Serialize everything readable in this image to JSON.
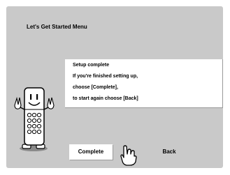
{
  "menu": {
    "title": "Let's Get Started Menu"
  },
  "message": {
    "lines": [
      "Setup complete",
      "If you're finished setting up,",
      "choose [Complete],",
      "to start again choose [Back]"
    ]
  },
  "buttons": {
    "complete_label": "Complete",
    "back_label": "Back",
    "selected": "Complete"
  },
  "colors": {
    "panel_background": "#c9c9c9",
    "box_background": "#ffffff",
    "text": "#000000"
  },
  "icons": {
    "mascot": "remote-control-mascot-icon",
    "cursor": "pointing-hand-icon"
  }
}
